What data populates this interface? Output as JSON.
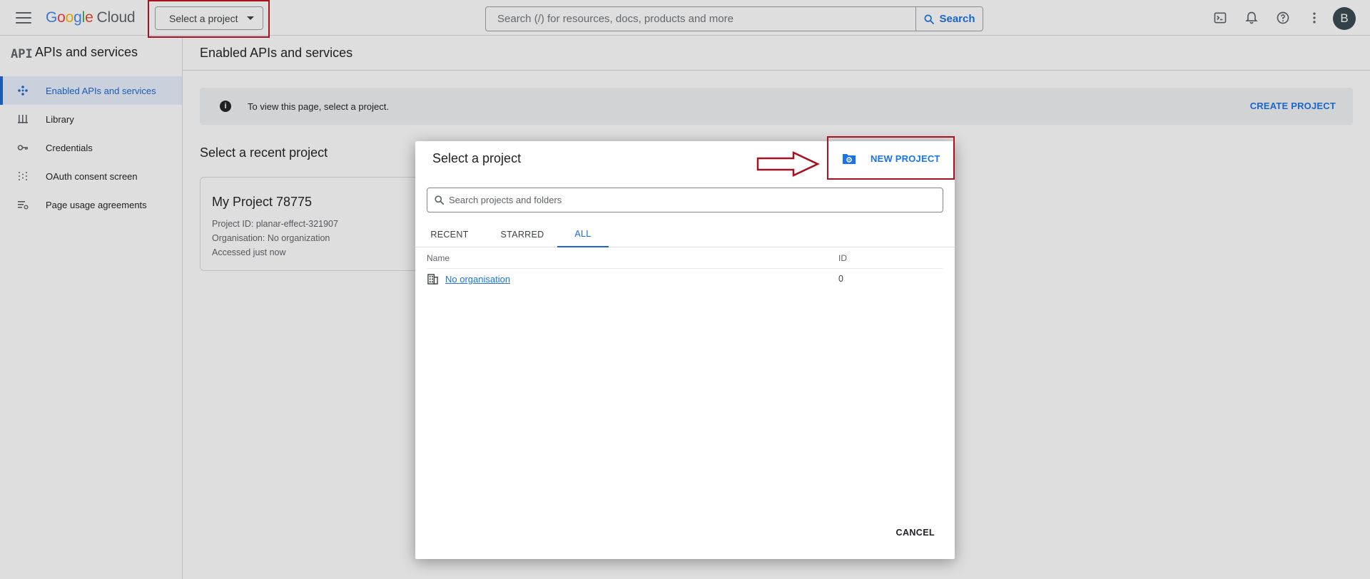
{
  "topbar": {
    "logo": {
      "google": "Google",
      "cloud": "Cloud"
    },
    "project_selector": "Select a project",
    "search": {
      "placeholder": "Search (/) for resources, docs, products and more",
      "button_label": "Search"
    },
    "avatar_initial": "B"
  },
  "sidebar": {
    "header_icon": "API",
    "title": "APIs and services",
    "items": [
      {
        "label": "Enabled APIs and services",
        "icon": "api-diamond-icon",
        "active": true
      },
      {
        "label": "Library",
        "icon": "library-icon",
        "active": false
      },
      {
        "label": "Credentials",
        "icon": "key-icon",
        "active": false
      },
      {
        "label": "OAuth consent screen",
        "icon": "oauth-icon",
        "active": false
      },
      {
        "label": "Page usage agreements",
        "icon": "settings-list-icon",
        "active": false
      }
    ]
  },
  "main": {
    "title": "Enabled APIs and services",
    "banner": {
      "text": "To view this page, select a project.",
      "action": "CREATE PROJECT"
    },
    "recent": {
      "title": "Select a recent project",
      "card": {
        "name": "My Project 78775",
        "project_id": "Project ID: planar-effect-321907",
        "organisation": "Organisation: No organization",
        "accessed": "Accessed just now"
      }
    }
  },
  "dialog": {
    "title": "Select a project",
    "new_project": "NEW PROJECT",
    "search_placeholder": "Search projects and folders",
    "tabs": [
      {
        "label": "RECENT",
        "active": false
      },
      {
        "label": "STARRED",
        "active": false
      },
      {
        "label": "ALL",
        "active": true
      }
    ],
    "columns": {
      "name": "Name",
      "id": "ID"
    },
    "rows": [
      {
        "name": "No organisation",
        "id": "0"
      }
    ],
    "cancel": "CANCEL"
  },
  "colors": {
    "accent": "#1a73e8",
    "highlight_frame": "#a8121f",
    "active_nav_bg": "#e8f0fe"
  }
}
